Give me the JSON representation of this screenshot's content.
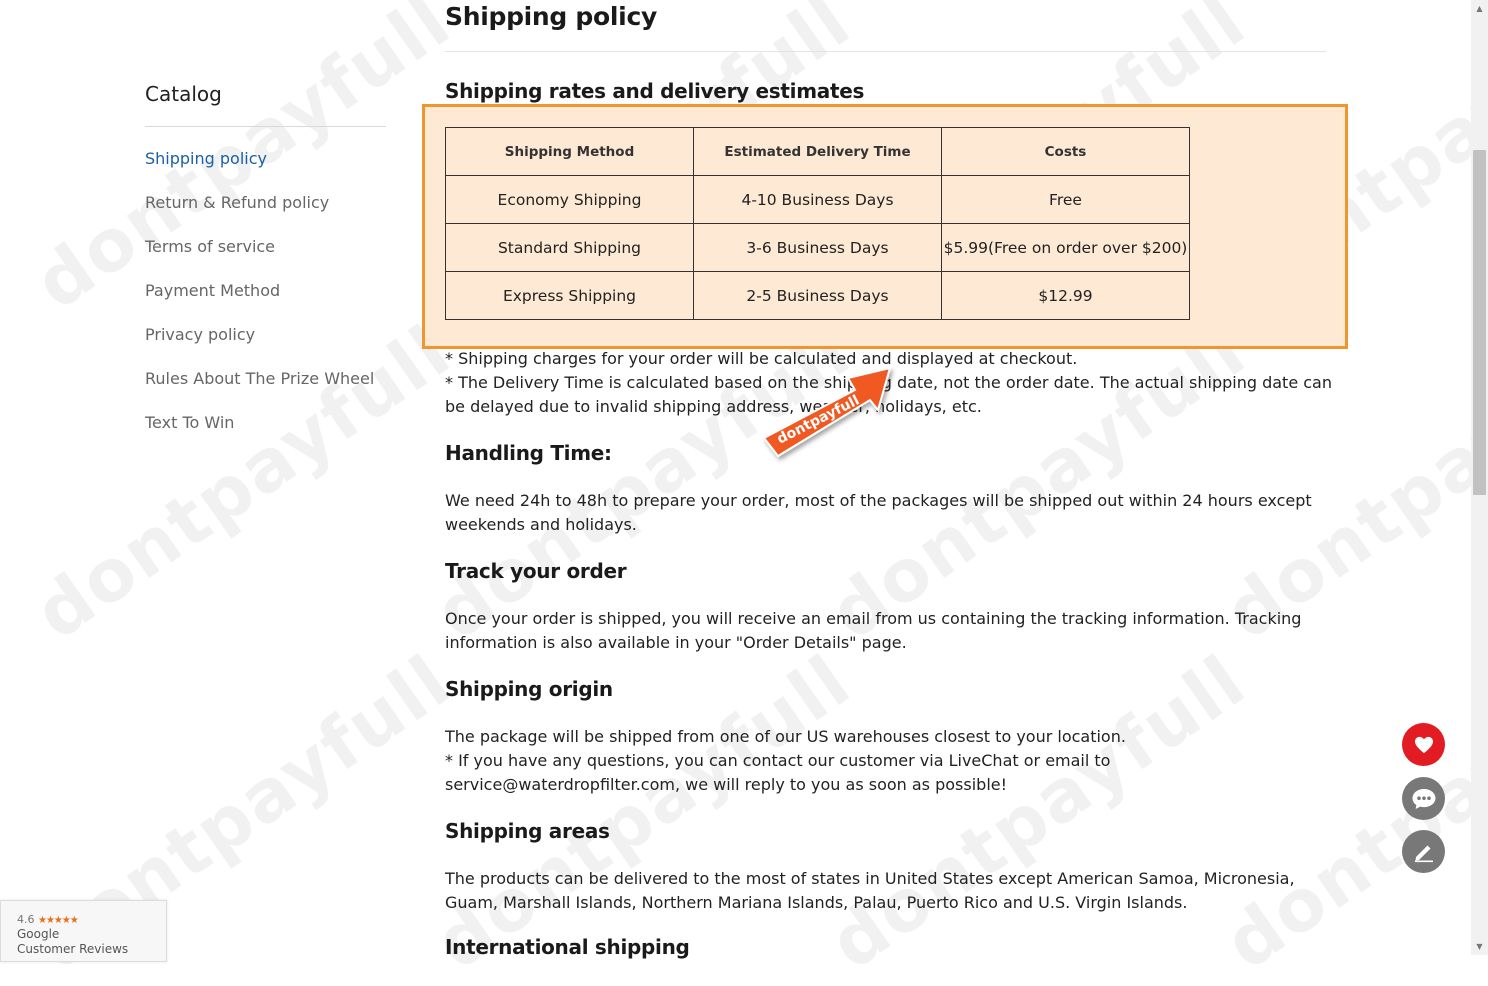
{
  "page": {
    "title": "Shipping policy"
  },
  "sidebar": {
    "title": "Catalog",
    "items": [
      {
        "label": "Shipping policy",
        "active": true
      },
      {
        "label": "Return & Refund policy"
      },
      {
        "label": "Terms of service"
      },
      {
        "label": "Payment Method"
      },
      {
        "label": "Privacy policy"
      },
      {
        "label": "Rules About The Prize Wheel"
      },
      {
        "label": "Text To Win"
      }
    ]
  },
  "rates": {
    "heading": "Shipping rates and delivery estimates",
    "columns": [
      "Shipping Method",
      "Estimated Delivery Time",
      "Costs"
    ],
    "rows": [
      [
        "Economy Shipping",
        "4-10 Business Days",
        "Free"
      ],
      [
        "Standard Shipping",
        "3-6 Business Days",
        "$5.99(Free on order over $200)"
      ],
      [
        "Express Shipping",
        "2-5 Business Days",
        "$12.99"
      ]
    ],
    "note1": "* Shipping charges for your order will be calculated and displayed at checkout.",
    "note2": "* The Delivery Time is calculated based on the shipping date, not the order date. The actual shipping date can be delayed due to invalid shipping address, weather, holidays, etc."
  },
  "handling": {
    "heading": "Handling Time:",
    "text": "We need 24h to 48h to prepare your order, most of the packages will be shipped out within 24 hours except weekends and holidays."
  },
  "track": {
    "heading": "Track your order",
    "text": "Once your order is shipped, you will receive an email from us containing the tracking information. Tracking information is also available in your \"Order Details\" page."
  },
  "origin": {
    "heading": "Shipping origin",
    "text1": "The package will be shipped from one of our US warehouses closest to your location.",
    "text2": "* If you have any questions, you can contact our customer via LiveChat or email to service@waterdropfilter.com, we will reply to you as soon as possible!"
  },
  "areas": {
    "heading": "Shipping areas",
    "text": "The products can be delivered to the most of states in United States except American Samoa, Micronesia, Guam, Marshall Islands, Northern Mariana Islands, Palau, Puerto Rico and U.S. Virgin Islands."
  },
  "international": {
    "heading": "International shipping"
  },
  "watermark": "dontpayfull",
  "sticker": "dontpayfull",
  "google_badge": {
    "rating": "4.6",
    "stars": "★★★★★",
    "brand": "Google",
    "label": "Customer Reviews"
  },
  "colors": {
    "accent_orange": "#f0962e",
    "highlight_bg": "#fde9d4",
    "link_blue": "#1a5fa8",
    "heart_red": "#e31b23"
  },
  "icons": {
    "fab1": "heart-icon",
    "fab2": "chat-icon",
    "fab3": "pencil-icon"
  }
}
